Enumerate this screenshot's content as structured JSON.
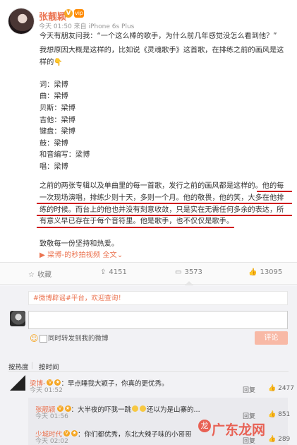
{
  "post": {
    "username": "张靓颖",
    "v_badge": "V",
    "vip_badge": "vip",
    "meta": "今天 01:50 来自 iPhone 6s Plus",
    "lines": [
      "今天有朋友问我：“一个这么棒的歌手，为什么前几年感觉没怎么看到他？”",
      "我想原因大概是这样的，比如说《灵魂歌手》这首歌，在排练之前的画风是这",
      "样的👇",
      "",
      "词：梁博",
      "曲：梁博",
      "贝斯：梁博",
      "吉他：梁博",
      "键盘：梁博",
      "鼓：梁博",
      "和音编写：梁博",
      "唱：梁博",
      "",
      "之前的两张专辑以及单曲里的每一首歌，发行之前的画风都是这样的。他的每",
      "一次现场演唱，排练少则十天，多则一个月。他的敬畏，他的笑，大多在他排",
      "练的时候。而台上的他也并没有刻意收敛，只是实在无需任何多余的表达，所",
      "有意义早已存在于每个音符里。他是歌手，也不仅仅是歌手。",
      "",
      "致敬每一份坚持和热爱。"
    ],
    "link_user": "梁博-",
    "link_video": "的秒拍视频",
    "link_all": "全文",
    "expand_arrow": "⌄"
  },
  "actions": {
    "favorite": "收藏",
    "repost": "4151",
    "comments": "3573",
    "likes": "13095"
  },
  "comment_panel": {
    "hashtag_prefix": "#微博辟谣#平台，",
    "hashtag_tail": "欢迎查询！",
    "checkbox_label": "同时转发到我的微博",
    "submit": "评论",
    "sort_hot": "按热度",
    "sort_sep": "|",
    "sort_time": "按时间"
  },
  "comments": [
    {
      "name": "梁博-",
      "text": "：早点睡我大颖子，你真的更优秀。",
      "time": "今天 01:52",
      "reply": "回复",
      "like": "2477"
    }
  ],
  "replies": [
    {
      "name": "张靓颖",
      "text": "：大半夜的吓我一跳",
      "text_after": "还以为是山寨的...",
      "time": "今天 01:56",
      "reply": "回复",
      "like": "851"
    },
    {
      "name": "少城时代",
      "text": "：你们都优秀，东北大辣子味的小哥哥",
      "time": "今天 02:02",
      "reply": "回复",
      "like": "289"
    }
  ],
  "watermark": "广东龙网",
  "colors": {
    "accent": "#eb7350",
    "underline": "#d0021b",
    "submit_bg": "#f8b9a6"
  },
  "icons": {
    "favorite": "star-icon",
    "repost": "repost-icon",
    "comment": "comment-icon",
    "like": "thumb-up-icon"
  }
}
